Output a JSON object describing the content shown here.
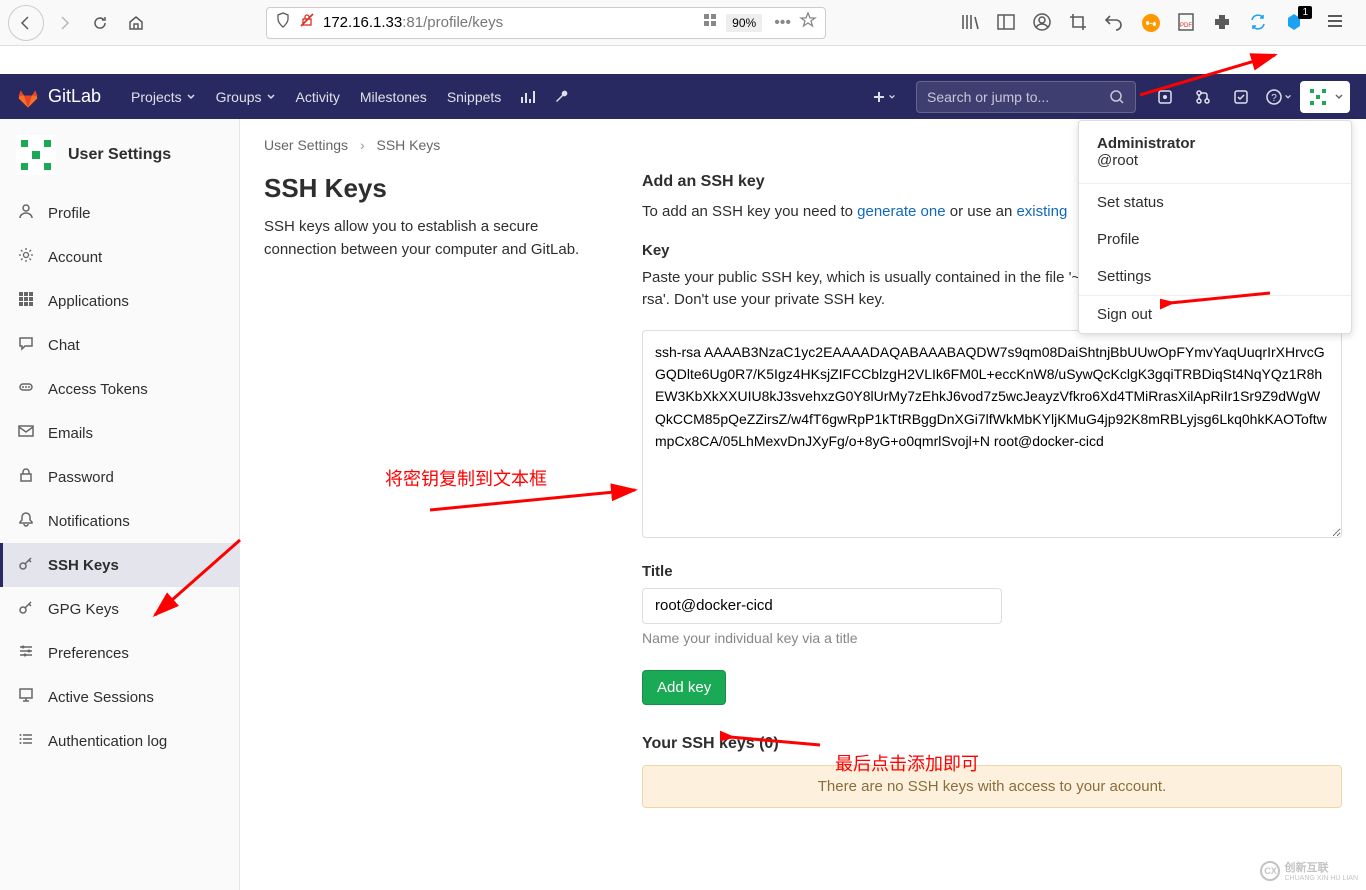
{
  "browser": {
    "url_prefix": "172.16.1.33",
    "url_suffix": ":81/profile/keys",
    "zoom": "90%",
    "notification_count": "1"
  },
  "gitlab_nav": {
    "brand": "GitLab",
    "items": [
      "Projects",
      "Groups",
      "Activity",
      "Milestones",
      "Snippets"
    ],
    "search_placeholder": "Search or jump to..."
  },
  "sidebar": {
    "title": "User Settings",
    "items": [
      {
        "label": "Profile",
        "icon": "user"
      },
      {
        "label": "Account",
        "icon": "cog"
      },
      {
        "label": "Applications",
        "icon": "apps"
      },
      {
        "label": "Chat",
        "icon": "chat"
      },
      {
        "label": "Access Tokens",
        "icon": "token"
      },
      {
        "label": "Emails",
        "icon": "mail"
      },
      {
        "label": "Password",
        "icon": "lock"
      },
      {
        "label": "Notifications",
        "icon": "bell"
      },
      {
        "label": "SSH Keys",
        "icon": "key",
        "active": true
      },
      {
        "label": "GPG Keys",
        "icon": "key"
      },
      {
        "label": "Preferences",
        "icon": "sliders"
      },
      {
        "label": "Active Sessions",
        "icon": "monitor"
      },
      {
        "label": "Authentication log",
        "icon": "list"
      }
    ]
  },
  "breadcrumb": {
    "root": "User Settings",
    "current": "SSH Keys"
  },
  "page": {
    "heading": "SSH Keys",
    "description": "SSH keys allow you to establish a secure connection between your computer and GitLab.",
    "add_heading": "Add an SSH key",
    "add_help_pre": "To add an SSH key you need to ",
    "add_help_link1": "generate one",
    "add_help_mid": " or use an ",
    "add_help_link2": "existing",
    "key_label": "Key",
    "key_help": "Paste your public SSH key, which is usually contained in the file '~/.ssh/id_rsa.pub' and begins with 'ssh-rsa'. Don't use your private SSH key.",
    "key_value": "ssh-rsa AAAAB3NzaC1yc2EAAAADAQABAAABAQDW7s9qm08DaiShtnjBbUUwOpFYmvYaqUuqrIrXHrvcGGQDlte6Ug0R7/K5Igz4HKsjZIFCCblzgH2VLIk6FM0L+eccKnW8/uSywQcKclgK3gqiTRBDiqSt4NqYQz1R8hEW3KbXkXXUIU8kJ3svehxzG0Y8lUrMy7zEhkJ6vod7z5wcJeayzVfkro6Xd4TMiRrasXilApRiIr1Sr9Z9dWgWQkCCM85pQeZZirsZ/w4fT6gwRpP1kTtRBggDnXGi7lfWkMbKYljKMuG4jp92K8mRBLyjsg6Lkq0hkKAOToftwmpCx8CA/05LhMexvDnJXyFg/o+8yG+o0qmrlSvojl+N root@docker-cicd",
    "title_label": "Title",
    "title_value": "root@docker-cicd",
    "title_hint": "Name your individual key via a title",
    "add_button": "Add key",
    "your_keys_heading": "Your SSH keys (0)",
    "empty_message": "There are no SSH keys with access to your account."
  },
  "dropdown": {
    "name": "Administrator",
    "handle": "@root",
    "items": [
      "Set status",
      "Profile",
      "Settings"
    ],
    "signout": "Sign out"
  },
  "annotations": {
    "a1": "将密钥复制到文本框",
    "a2": "最后点击添加即可"
  },
  "watermark": {
    "text": "创新互联",
    "sub": "CHUANG XIN HU LIAN",
    "badge": "CX"
  }
}
